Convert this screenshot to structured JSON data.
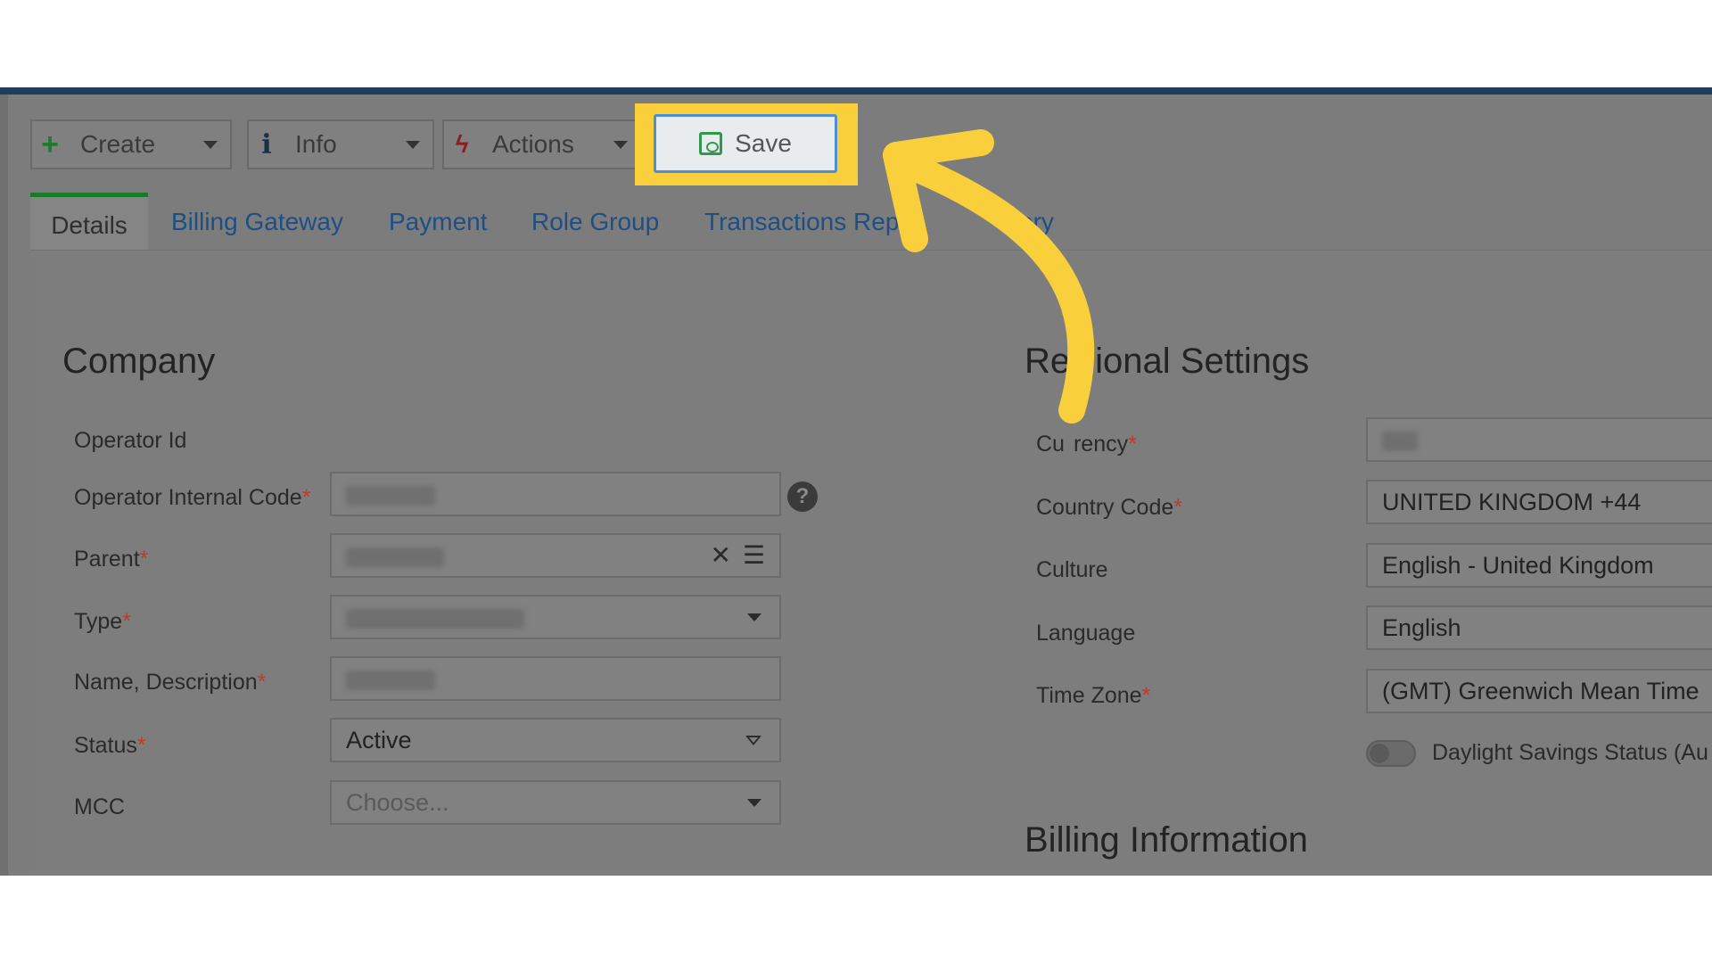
{
  "toolbar": {
    "create_label": "Create",
    "info_label": "Info",
    "actions_label": "Actions",
    "save_label": "Save"
  },
  "tabs": [
    {
      "label": "Details",
      "active": true
    },
    {
      "label": "Billing Gateway"
    },
    {
      "label": "Payment"
    },
    {
      "label": "Role Group"
    },
    {
      "label": "Transactions Repo"
    },
    {
      "label": "ory"
    }
  ],
  "company": {
    "heading": "Company",
    "fields": {
      "operator_id": {
        "label": "Operator Id"
      },
      "operator_internal_code": {
        "label": "Operator Internal Code",
        "required": "*"
      },
      "parent": {
        "label": "Parent",
        "required": "*"
      },
      "type": {
        "label": "Type",
        "required": "*"
      },
      "name_description": {
        "label": "Name, Description",
        "required": "*"
      },
      "status": {
        "label": "Status",
        "required": "*",
        "value": "Active"
      },
      "mcc": {
        "label": "MCC",
        "placeholder": "Choose..."
      }
    }
  },
  "regional": {
    "heading": "Re",
    "heading_rest": "ional Settings",
    "fields": {
      "currency": {
        "label": "Cu",
        "label_rest": "rency",
        "required": "*"
      },
      "country_code": {
        "label": "Country Code",
        "required": "*",
        "value": "UNITED KINGDOM +44"
      },
      "culture": {
        "label": "Culture",
        "value": "English - United Kingdom"
      },
      "language": {
        "label": "Language",
        "value": "English"
      },
      "time_zone": {
        "label": "Time Zone",
        "required": "*",
        "value": "(GMT) Greenwich Mean Time"
      },
      "daylight_savings": {
        "label": "Daylight Savings Status (Au"
      }
    }
  },
  "billing": {
    "heading": "Billing Information"
  },
  "colors": {
    "highlight": "#f9cf3c",
    "arrow": "#f9cf3c",
    "nav_bar": "#1f3d5e",
    "active_tab_accent": "#1a7a2c",
    "link": "#1d4f85"
  },
  "icons": {
    "create": "plus-icon",
    "info": "info-icon",
    "actions": "bolt-icon",
    "save": "floppy-disk-icon",
    "help": "question-circle-icon",
    "clear": "close-icon",
    "list": "list-icon"
  }
}
